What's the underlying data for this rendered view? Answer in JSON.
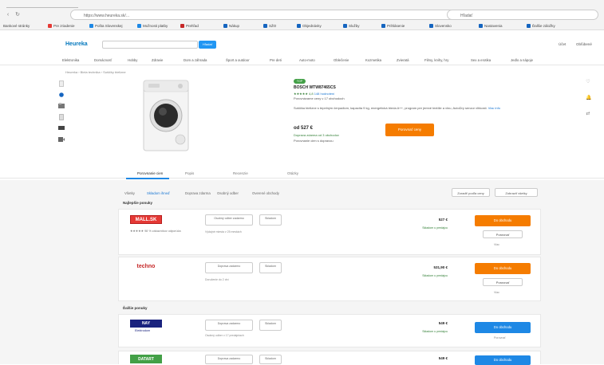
{
  "browser": {
    "url": "https://www.heureka.sk/...",
    "search_placeholder": "Hľadať",
    "bookmarks": [
      "Bankové stránky",
      "Pre zriadenie",
      "Pošta Slovenskej",
      "Možnosti platby",
      "Prehľad",
      "Nákup",
      "SŽO",
      "Objednávky",
      "Služby",
      "Prihlásenie",
      "Slovensko",
      "Nastavenia",
      "Ďalšie záložky"
    ]
  },
  "site": {
    "logo": "Heureka",
    "search_button": "Hľadať",
    "account": "Účet",
    "cart": "Obľúbené"
  },
  "categories": [
    "Elektronika",
    "Domácnosť",
    "Hobby",
    "Zdravie",
    "Dom a záhrada",
    "Šport a outdoor",
    "Pre deti",
    "Auto-moto",
    "Oblečenie",
    "Kozmetika",
    "Zvieratá",
    "Filmy, knihy, hry",
    "Sex a erotika",
    "Jedlo a nápoje"
  ],
  "breadcrumb": "Heureka › Biela technika › Sušičky bielizne",
  "product": {
    "badge": "TOP",
    "title": "BOSCH WTW87465CS",
    "rating_text": "★★★★★ 4,8",
    "reviews_link": "148 hodnotení",
    "note": "Porovnávame ceny v 17 obchodoch",
    "description": "Sušička bielizne s tepelným čerpadlom, kapacita 9 kg, energetická trieda A++, program pre jemné textílie a vlnu, AutoDry senzor vlhkosti.",
    "description_link": "Viac info",
    "price": "od 527 €",
    "shipping": "Doprava zdarma od 3 obchodov",
    "shipping_note": "Porovnanie cien s dopravou",
    "compare_button": "Porovnať ceny"
  },
  "tabs": [
    "Porovnanie cien",
    "Popis",
    "Recenzie",
    "Otázky"
  ],
  "filters": [
    "Všetky",
    "Skladom ihneď",
    "Doprava zdarma",
    "Osobný odber",
    "Overené obchody"
  ],
  "sort": [
    "Zoradiť podľa ceny",
    "Zobraziť všetky"
  ],
  "groups": [
    "Najlepšie ponuky",
    "Ďalšie ponuky"
  ],
  "offers": [
    {
      "shop": "MALL.SK",
      "shop_sub": "★★★★★ 98 % zákazníkov odporúča",
      "pill_main": "Osobný odber zadarmo",
      "pill_side": "Skladom",
      "pill_note": "Výdajné miesta v 25 mestách",
      "price": "527 €",
      "avail": "Skladom u predajcu",
      "button": "Do obchodu",
      "secondary": "Porovnať",
      "note": "Viac",
      "color": "#f57c00"
    },
    {
      "shop": "techno",
      "shop_sub": "",
      "pill_main": "Doprava zadarmo",
      "pill_side": "Skladom",
      "pill_note": "Doručenie do 2 dní",
      "price": "531,90 €",
      "avail": "Skladom u predajcu",
      "button": "Do obchodu",
      "secondary": "Porovnať",
      "note": "Viac",
      "color": "#f57c00"
    },
    {
      "shop": "NAY",
      "shop_sub": "Elektrodom",
      "pill_main": "Doprava zadarmo",
      "pill_side": "Skladom",
      "pill_note": "Osobný odber v 17 predajniach",
      "price": "549 €",
      "avail": "Skladom u predajcu",
      "button": "Do obchodu",
      "secondary": "",
      "note": "Porovnať",
      "color": "#1e88e5"
    },
    {
      "shop": "DATART",
      "shop_sub": "",
      "pill_main": "Doprava zadarmo",
      "pill_side": "Skladom",
      "pill_note": "",
      "price": "549 €",
      "avail": "",
      "button": "Do obchodu",
      "secondary": "",
      "note": "",
      "color": "#1e88e5"
    }
  ],
  "colors": {
    "accent": "#f57c00",
    "blue": "#1e88e5",
    "link": "#1976d2",
    "green": "#2e7d32"
  }
}
